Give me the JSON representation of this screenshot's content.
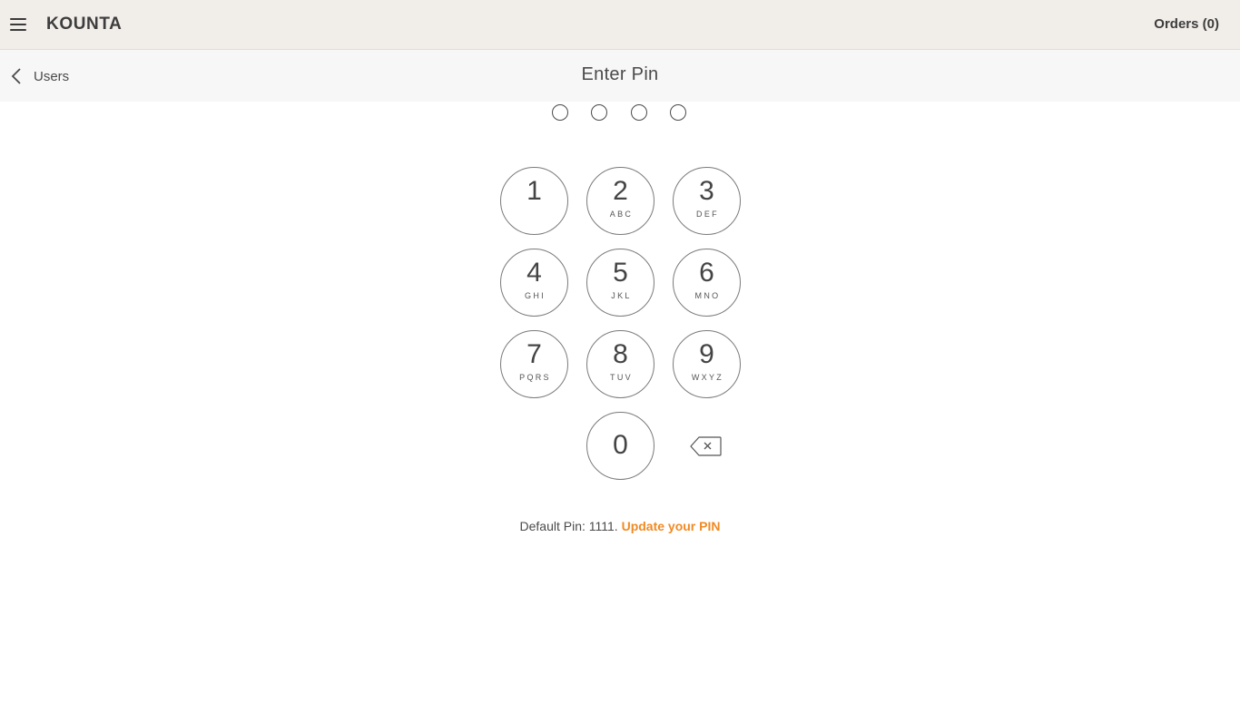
{
  "header": {
    "logo": "KOUNTA",
    "orders_link": "Orders (0)",
    "menu_icon": "hamburger-menu-icon"
  },
  "subheader": {
    "back_label": "Users",
    "back_icon": "chevron-left-icon",
    "title": "Enter Pin"
  },
  "pin": {
    "length": 4,
    "entered": 0
  },
  "keypad": {
    "keys": [
      {
        "digit": "1",
        "letters": ""
      },
      {
        "digit": "2",
        "letters": "ABC"
      },
      {
        "digit": "3",
        "letters": "DEF"
      },
      {
        "digit": "4",
        "letters": "GHI"
      },
      {
        "digit": "5",
        "letters": "JKL"
      },
      {
        "digit": "6",
        "letters": "MNO"
      },
      {
        "digit": "7",
        "letters": "PQRS"
      },
      {
        "digit": "8",
        "letters": "TUV"
      },
      {
        "digit": "9",
        "letters": "WXYZ"
      },
      {
        "digit": "0",
        "letters": ""
      }
    ],
    "backspace_icon": "backspace-icon"
  },
  "footer": {
    "default_pin_text": "Default Pin: 1111.",
    "update_link": "Update your PIN"
  },
  "colors": {
    "accent": "#f08a24",
    "topbar_bg": "#f1ede9",
    "subbar_bg": "#f7f7f7",
    "text": "#4a4a4a"
  }
}
